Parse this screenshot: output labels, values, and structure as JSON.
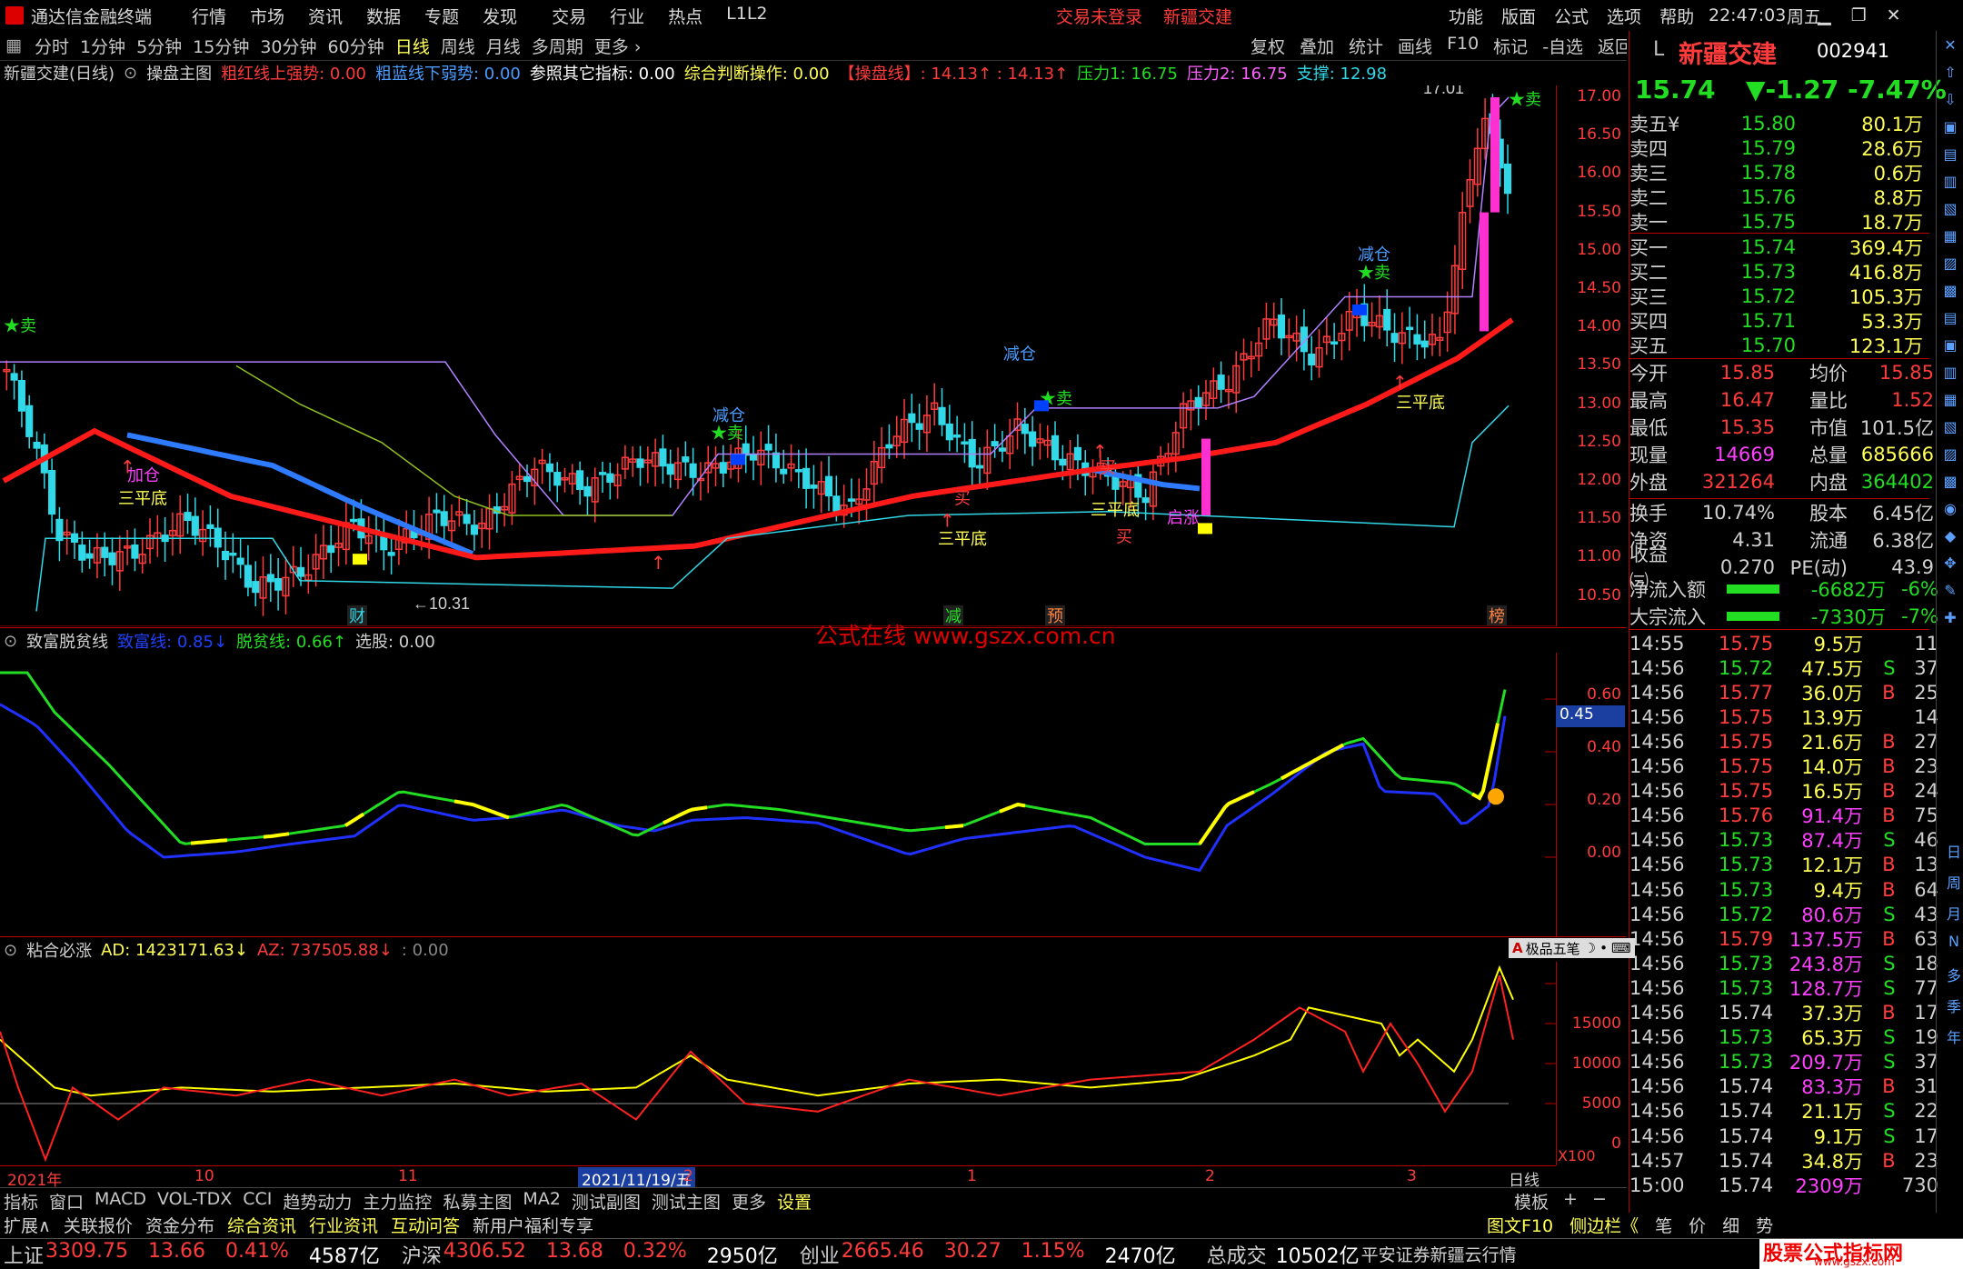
{
  "titlebar": {
    "app_name": "通达信金融终端",
    "menu": [
      "行情",
      "市场",
      "资讯",
      "数据",
      "专题",
      "发现",
      "交易",
      "行业",
      "热点",
      "L1L2"
    ],
    "login_status": "交易未登录",
    "stock_name": "新疆交建",
    "right_menu": [
      "功能",
      "版面",
      "公式",
      "选项",
      "帮助"
    ],
    "time": "22:47:03",
    "weekday": "周五"
  },
  "periodbar": {
    "periods": [
      "分时",
      "1分钟",
      "5分钟",
      "15分钟",
      "30分钟",
      "60分钟",
      "日线",
      "周线",
      "月线",
      "多周期",
      "更多 ›"
    ],
    "active": "日线",
    "right_buttons": [
      "复权",
      "叠加",
      "统计",
      "画线",
      "F10",
      "标记",
      "-自选",
      "返回"
    ]
  },
  "main_chart": {
    "header": {
      "name": "新疆交建(日线)",
      "indicator": "操盘主图",
      "items": [
        {
          "text": "粗红线上强势: 0.00",
          "color": "#ff3b3b"
        },
        {
          "text": "粗蓝线下弱势: 0.00",
          "color": "#4a9cff"
        },
        {
          "text": "参照其它指标: 0.00",
          "color": "#ffffff"
        },
        {
          "text": "综合判断操作: 0.00",
          "color": "#ffff54"
        },
        {
          "text": "【操盘线】: 14.13↑  : 14.13↑",
          "color": "#ff3b3b"
        },
        {
          "text": "压力1: 16.75",
          "color": "#22dd22"
        },
        {
          "text": "压力2: 16.75",
          "color": "#ff60ff"
        },
        {
          "text": "支撑: 12.98",
          "color": "#30d8e8"
        }
      ]
    },
    "y_ticks": [
      "17.00",
      "16.50",
      "16.00",
      "15.50",
      "15.00",
      "14.50",
      "14.00",
      "13.50",
      "13.00",
      "12.50",
      "12.00",
      "11.50",
      "11.00",
      "10.50"
    ],
    "labels": [
      {
        "text": "17.01",
        "color": "#d0d0d0"
      },
      {
        "text": "←10.31",
        "color": "#d0d0d0"
      },
      {
        "text": "三平底",
        "color": "#ffff54"
      },
      {
        "text": "三平底",
        "color": "#ffff54"
      },
      {
        "text": "三平底",
        "color": "#ffff54"
      },
      {
        "text": "三平底",
        "color": "#ffff54"
      },
      {
        "text": "减仓",
        "color": "#4a9cff"
      },
      {
        "text": "减仓",
        "color": "#4a9cff"
      },
      {
        "text": "减仓",
        "color": "#4a9cff"
      },
      {
        "text": "加仓",
        "color": "#ff40ff"
      },
      {
        "text": "★卖",
        "color": "#22dd22"
      },
      {
        "text": "★卖",
        "color": "#22dd22"
      },
      {
        "text": "★卖",
        "color": "#22dd22"
      },
      {
        "text": "★卖",
        "color": "#22dd22"
      },
      {
        "text": "★卖",
        "color": "#22dd22"
      },
      {
        "text": "买",
        "color": "#ff3b3b"
      },
      {
        "text": "买",
        "color": "#ff3b3b"
      },
      {
        "text": "买",
        "color": "#ff3b3b"
      },
      {
        "text": "启涨",
        "color": "#ff40ff"
      }
    ],
    "markers": [
      "财",
      "减",
      "预",
      "榜"
    ]
  },
  "watermark": "公式在线  www.gszx.com.cn",
  "panel2": {
    "header": {
      "name": "致富脱贫线",
      "items": [
        {
          "text": "致富线: 0.85↓",
          "color": "#2040ff"
        },
        {
          "text": "脱贫线: 0.66↑",
          "color": "#22dd22"
        },
        {
          "text": "选股: 0.00",
          "color": "#d0d0d0"
        }
      ]
    },
    "y_ticks": [
      "0.60",
      "0.40",
      "0.20",
      "0.00"
    ],
    "highlight_value": "0.45"
  },
  "panel3": {
    "header": {
      "name": "粘合必涨",
      "items": [
        {
          "text": "AD: 1423171.63↓",
          "color": "#ffff54"
        },
        {
          "text": "AZ: 737505.88↓",
          "color": "#ff3b3b"
        },
        {
          "text": ": 0.00",
          "color": "#888888"
        }
      ]
    },
    "y_ticks": [
      "15000",
      "10000",
      "5000",
      "0"
    ],
    "pen_tool": "极品五笔",
    "scale_label": "X100"
  },
  "date_axis": [
    "2021年",
    "10",
    "11",
    "2021/11/19/五",
    "2",
    "1",
    "2",
    "3",
    "日线"
  ],
  "quote": {
    "code_label": "L",
    "name": "新疆交建",
    "code": "002941",
    "price": "15.74",
    "change": "▼-1.27",
    "change_pct": "-7.47%",
    "asks": [
      {
        "label": "卖五¥",
        "price": "15.80",
        "vol": "80.1万"
      },
      {
        "label": "卖四",
        "price": "15.79",
        "vol": "28.6万"
      },
      {
        "label": "卖三",
        "price": "15.78",
        "vol": "0.6万"
      },
      {
        "label": "卖二",
        "price": "15.76",
        "vol": "8.8万"
      },
      {
        "label": "卖一",
        "price": "15.75",
        "vol": "18.7万"
      }
    ],
    "bids": [
      {
        "label": "买一",
        "price": "15.74",
        "vol": "369.4万"
      },
      {
        "label": "买二",
        "price": "15.73",
        "vol": "416.8万"
      },
      {
        "label": "买三",
        "price": "15.72",
        "vol": "105.3万"
      },
      {
        "label": "买四",
        "price": "15.71",
        "vol": "53.3万"
      },
      {
        "label": "买五",
        "price": "15.70",
        "vol": "123.1万"
      }
    ],
    "stats": [
      {
        "l1": "今开",
        "v1": "15.85",
        "l2": "均价",
        "v2": "15.85",
        "c1": "#ff3b3b",
        "c2": "#ff3b3b"
      },
      {
        "l1": "最高",
        "v1": "16.47",
        "l2": "量比",
        "v2": "1.52",
        "c1": "#ff3b3b",
        "c2": "#ff3b3b"
      },
      {
        "l1": "最低",
        "v1": "15.35",
        "l2": "市值",
        "v2": "101.5亿",
        "c1": "#ff3b3b",
        "c2": "#d0d0d0"
      },
      {
        "l1": "现量",
        "v1": "14669",
        "l2": "总量",
        "v2": "685666",
        "c1": "#ff40ff",
        "c2": "#ffff54"
      },
      {
        "l1": "外盘",
        "v1": "321264",
        "l2": "内盘",
        "v2": "364402",
        "c1": "#ff3b3b",
        "c2": "#22dd22"
      },
      {
        "l1": "换手",
        "v1": "10.74%",
        "l2": "股本",
        "v2": "6.45亿",
        "c1": "#d0d0d0",
        "c2": "#d0d0d0"
      },
      {
        "l1": "净资",
        "v1": "4.31",
        "l2": "流通",
        "v2": "6.38亿",
        "c1": "#d0d0d0",
        "c2": "#d0d0d0"
      },
      {
        "l1": "收益㈢",
        "v1": "0.270",
        "l2": "PE(动)",
        "v2": "43.9",
        "c1": "#d0d0d0",
        "c2": "#d0d0d0"
      }
    ],
    "flows": [
      {
        "label": "净流入额",
        "value": "-6682万",
        "pct": "-6%"
      },
      {
        "label": "大宗流入",
        "value": "-7330万",
        "pct": "-7%"
      }
    ],
    "ticks": [
      {
        "t": "14:55",
        "p": "15.75",
        "v": "9.5万",
        "s": "",
        "n": "11"
      },
      {
        "t": "14:56",
        "p": "15.72",
        "v": "47.5万",
        "s": "S",
        "n": "37"
      },
      {
        "t": "14:56",
        "p": "15.77",
        "v": "36.0万",
        "s": "B",
        "n": "25"
      },
      {
        "t": "14:56",
        "p": "15.75",
        "v": "13.9万",
        "s": "",
        "n": "14"
      },
      {
        "t": "14:56",
        "p": "15.75",
        "v": "21.6万",
        "s": "B",
        "n": "27"
      },
      {
        "t": "14:56",
        "p": "15.75",
        "v": "14.0万",
        "s": "B",
        "n": "23"
      },
      {
        "t": "14:56",
        "p": "15.75",
        "v": "16.5万",
        "s": "B",
        "n": "24"
      },
      {
        "t": "14:56",
        "p": "15.76",
        "v": "91.4万",
        "s": "B",
        "n": "75"
      },
      {
        "t": "14:56",
        "p": "15.73",
        "v": "87.4万",
        "s": "S",
        "n": "46"
      },
      {
        "t": "14:56",
        "p": "15.73",
        "v": "12.1万",
        "s": "B",
        "n": "13"
      },
      {
        "t": "14:56",
        "p": "15.73",
        "v": "9.4万",
        "s": "B",
        "n": "64"
      },
      {
        "t": "14:56",
        "p": "15.72",
        "v": "80.6万",
        "s": "S",
        "n": "43"
      },
      {
        "t": "14:56",
        "p": "15.79",
        "v": "137.5万",
        "s": "B",
        "n": "63"
      },
      {
        "t": "14:56",
        "p": "15.73",
        "v": "243.8万",
        "s": "S",
        "n": "18"
      },
      {
        "t": "14:56",
        "p": "15.73",
        "v": "128.7万",
        "s": "S",
        "n": "77"
      },
      {
        "t": "14:56",
        "p": "15.74",
        "v": "37.3万",
        "s": "B",
        "n": "17"
      },
      {
        "t": "14:56",
        "p": "15.73",
        "v": "65.3万",
        "s": "S",
        "n": "19"
      },
      {
        "t": "14:56",
        "p": "15.73",
        "v": "209.7万",
        "s": "S",
        "n": "37"
      },
      {
        "t": "14:56",
        "p": "15.74",
        "v": "83.3万",
        "s": "B",
        "n": "31"
      },
      {
        "t": "14:56",
        "p": "15.74",
        "v": "21.1万",
        "s": "S",
        "n": "22"
      },
      {
        "t": "14:56",
        "p": "15.74",
        "v": "9.1万",
        "s": "S",
        "n": "17"
      },
      {
        "t": "14:57",
        "p": "15.74",
        "v": "34.8万",
        "s": "B",
        "n": "23"
      },
      {
        "t": "15:00",
        "p": "15.74",
        "v": "2309万",
        "s": "",
        "n": "730"
      }
    ],
    "side_icons": [
      "日",
      "周",
      "月",
      "N",
      "多",
      "季",
      "年"
    ]
  },
  "bottomtabs": {
    "tabs": [
      "指标",
      "窗口",
      "MACD",
      "VOL-TDX",
      "CCI",
      "趋势动力",
      "主力监控",
      "私募主图",
      "MA2",
      "测试副图",
      "测试主图",
      "更多",
      "设置"
    ],
    "active": "设置",
    "right": [
      "模板",
      "+",
      "−"
    ]
  },
  "infotabs": {
    "tabs": [
      {
        "text": "扩展∧",
        "color": "#d0d0d0"
      },
      {
        "text": "关联报价",
        "color": "#d0d0d0"
      },
      {
        "text": "资金分布",
        "color": "#d0d0d0"
      },
      {
        "text": "综合资讯",
        "color": "#ffff54"
      },
      {
        "text": "行业资讯",
        "color": "#ffff54"
      },
      {
        "text": "互动问答",
        "color": "#ffff54"
      },
      {
        "text": "新用户福利专享",
        "color": "#d0d0d0"
      }
    ],
    "right": [
      {
        "text": "图文F10",
        "color": "#ffff54"
      },
      {
        "text": "侧边栏《",
        "color": "#ffff54"
      },
      {
        "text": "笔",
        "color": "#d0d0d0"
      },
      {
        "text": "价",
        "color": "#d0d0d0"
      },
      {
        "text": "细",
        "color": "#d0d0d0"
      },
      {
        "text": "势",
        "color": "#d0d0d0"
      }
    ]
  },
  "indexbar": {
    "items": [
      {
        "name": "上证",
        "v": "3309.75",
        "c": "13.66",
        "p": "0.41%",
        "amt": "4587亿"
      },
      {
        "name": "沪深",
        "v": "4306.52",
        "c": "13.68",
        "p": "0.32%",
        "amt": "2950亿"
      },
      {
        "name": "创业",
        "v": "2665.46",
        "c": "30.27",
        "p": "1.15%",
        "amt": "2470亿"
      }
    ],
    "total_label": "总成交",
    "total_value": "10502亿",
    "broker": "平安证券新疆云行情",
    "logo_text": "股票公式指标网",
    "logo_url": "www.gszx.com"
  },
  "colors": {
    "up": "#ff3b3b",
    "down": "#22dd22",
    "bg": "#000000",
    "accent": "#ffff54",
    "magenta": "#ff40ff",
    "cyan": "#30d8e8"
  }
}
